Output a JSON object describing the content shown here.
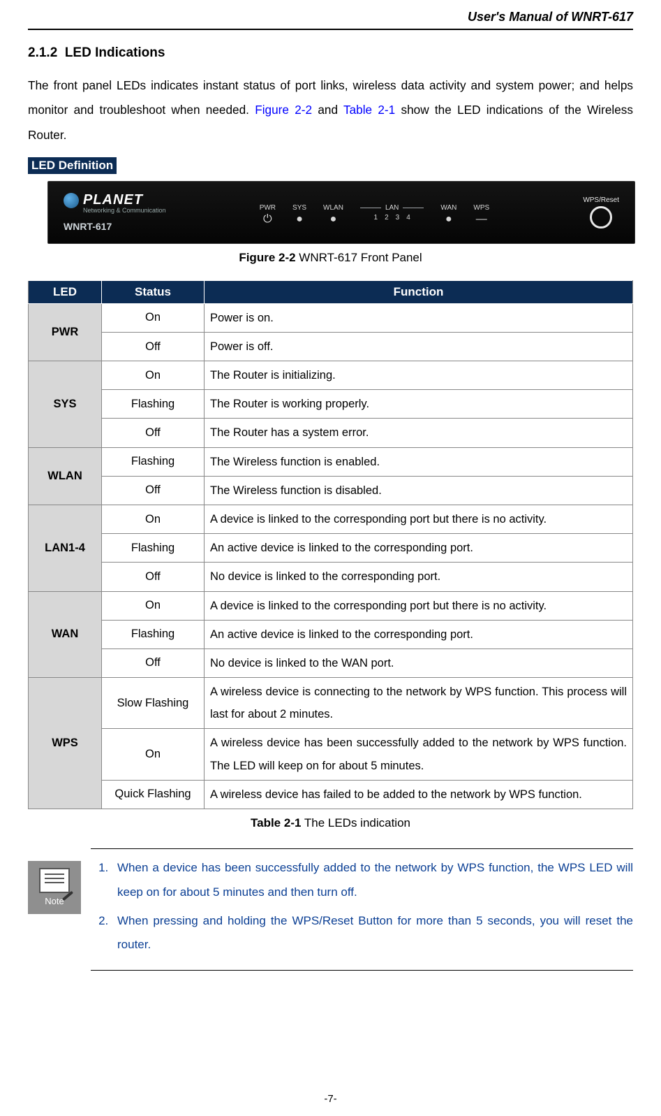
{
  "running_header": "User's Manual of WNRT-617",
  "section": {
    "number": "2.1.2",
    "title": "LED Indications"
  },
  "intro": {
    "part1": "The front panel LEDs indicates instant status of port links, wireless data activity and system power; and helps monitor and troubleshoot when needed. ",
    "ref1": "Figure 2-2",
    "mid": " and ",
    "ref2": "Table 2-1",
    "part2": " show the LED indications of the Wireless Router."
  },
  "led_def_label": "LED Definition",
  "panel": {
    "brand": "PLANET",
    "brand_sub": "Networking & Communication",
    "model": "WNRT-617",
    "labels": {
      "pwr": "PWR",
      "sys": "SYS",
      "wlan": "WLAN",
      "lan": "LAN",
      "lan1": "1",
      "lan2": "2",
      "lan3": "3",
      "lan4": "4",
      "wan": "WAN",
      "wps": "WPS",
      "wps_reset": "WPS/Reset",
      "power_icon": "⏻",
      "dot": "●",
      "dash": "—"
    }
  },
  "figure_caption": {
    "bold": "Figure 2-2",
    "rest": "  WNRT-617 Front Panel"
  },
  "table": {
    "headers": {
      "led": "LED",
      "status": "Status",
      "function": "Function"
    },
    "groups": [
      {
        "led": "PWR",
        "rows": [
          {
            "status": "On",
            "function": "Power is on."
          },
          {
            "status": "Off",
            "function": "Power is off."
          }
        ]
      },
      {
        "led": "SYS",
        "rows": [
          {
            "status": "On",
            "function": "The Router is initializing."
          },
          {
            "status": "Flashing",
            "function": "The Router is working properly."
          },
          {
            "status": "Off",
            "function": "The Router has a system error."
          }
        ]
      },
      {
        "led": "WLAN",
        "rows": [
          {
            "status": "Flashing",
            "function": "The Wireless function is enabled."
          },
          {
            "status": "Off",
            "function": "The Wireless function is disabled."
          }
        ]
      },
      {
        "led": "LAN1-4",
        "rows": [
          {
            "status": "On",
            "function": "A device is linked to the corresponding port but there is no activity."
          },
          {
            "status": "Flashing",
            "function": "An active device is linked to the corresponding port."
          },
          {
            "status": "Off",
            "function": "No device is linked to the corresponding port."
          }
        ]
      },
      {
        "led": "WAN",
        "rows": [
          {
            "status": "On",
            "function": "A device is linked to the corresponding port but there is no activity."
          },
          {
            "status": "Flashing",
            "function": "An active device is linked to the corresponding port."
          },
          {
            "status": "Off",
            "function": "No device is linked to the WAN port."
          }
        ]
      },
      {
        "led": "WPS",
        "rows": [
          {
            "status": "Slow Flashing",
            "function": "A wireless device is connecting to the network by WPS function. This process will last for about 2 minutes."
          },
          {
            "status": "On",
            "function": "A wireless device has been successfully added to the network by WPS function. The LED will keep on for about 5 minutes."
          },
          {
            "status": "Quick Flashing",
            "function": "A wireless device has failed to be added to the network by WPS function."
          }
        ]
      }
    ]
  },
  "table_caption": {
    "bold": "Table 2-1",
    "rest": "  The LEDs indication"
  },
  "note": {
    "label": "Note",
    "items": [
      "When a device has been successfully added to the network by WPS function, the WPS LED will keep on for about 5 minutes and then turn off.",
      "When pressing and holding the WPS/Reset Button for more than 5 seconds, you will reset the router."
    ]
  },
  "page_number": "-7-"
}
